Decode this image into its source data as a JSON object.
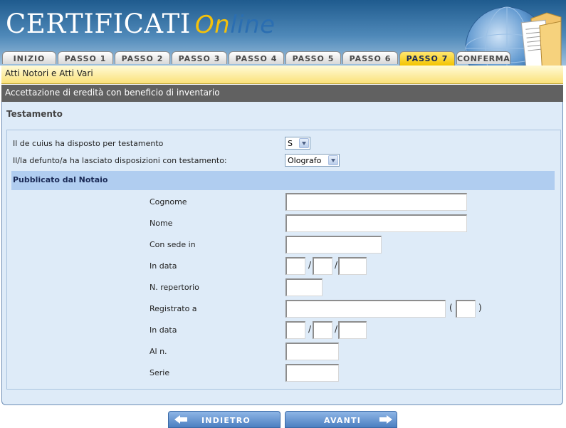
{
  "header": {
    "title_main": "CERTIFICATI",
    "title_on": "On",
    "title_line": "line"
  },
  "tabs": [
    {
      "label": "INIZIO",
      "active": false
    },
    {
      "label": "PASSO 1",
      "active": false
    },
    {
      "label": "PASSO 2",
      "active": false
    },
    {
      "label": "PASSO 3",
      "active": false
    },
    {
      "label": "PASSO 4",
      "active": false
    },
    {
      "label": "PASSO 5",
      "active": false
    },
    {
      "label": "PASSO 6",
      "active": false
    },
    {
      "label": "PASSO 7",
      "active": true
    },
    {
      "label": "CONFERMA",
      "active": false
    }
  ],
  "category_bar": "Atti Notori e Atti Vari",
  "page_bar": "Accettazione di eredità con beneficio di inventario",
  "section": {
    "title": "Testamento",
    "question1": "Il de cuius ha disposto per testamento",
    "question1_value": "S",
    "question2": "Il/la defunto/a ha lasciato disposizioni con testamento:",
    "question2_value": "Olografo"
  },
  "notaio": {
    "band_title": "Pubblicato dal Notaio",
    "cognome": "Cognome",
    "nome": "Nome",
    "con_sede_in": "Con sede in",
    "in_data": "In data",
    "n_repertorio": "N. repertorio",
    "registrato_a": "Registrato a",
    "in_data2": "In data",
    "al_n": "Al n.",
    "serie": "Serie",
    "slash": "/",
    "paren_open": "(",
    "paren_close": ")"
  },
  "footer": {
    "back_label": "INDIETRO",
    "next_label": "AVANTI"
  },
  "colors": {
    "header_blue": "#1f5b8e",
    "accent_yellow": "#f4c10a",
    "panel_bg": "#deebf8",
    "band_bg": "#b0cdf0",
    "gray_bar": "#616161"
  }
}
